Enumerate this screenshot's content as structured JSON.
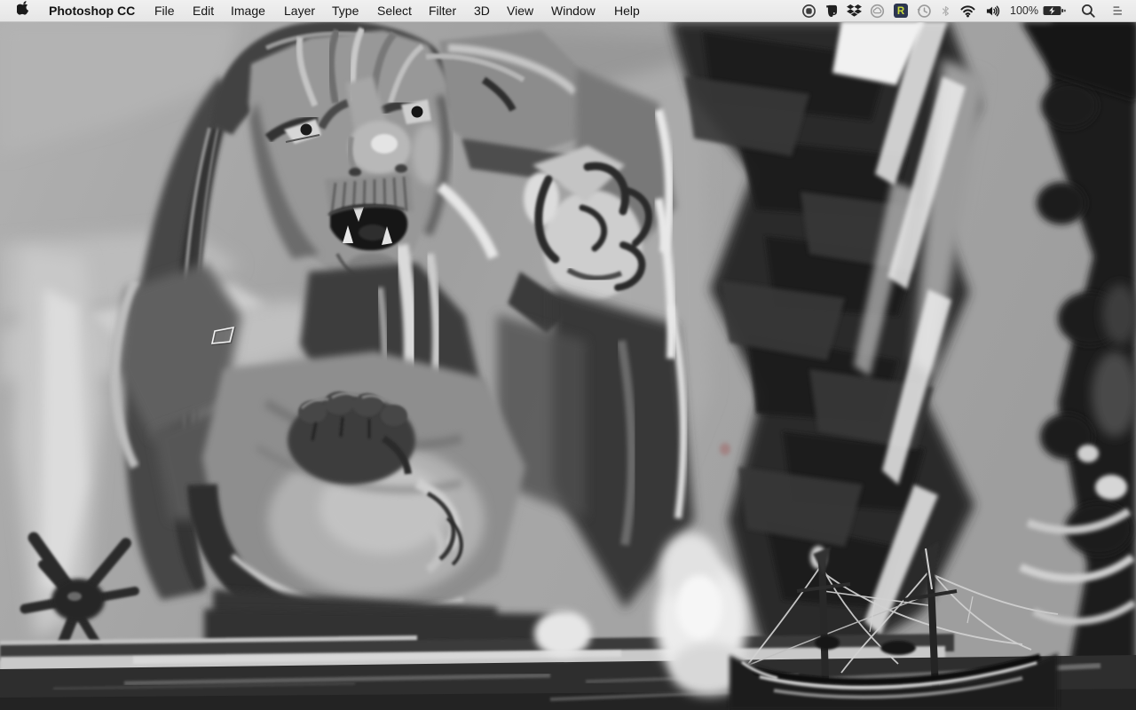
{
  "menu_bar": {
    "app_name": "Photoshop CC",
    "menus": [
      "File",
      "Edit",
      "Image",
      "Layer",
      "Type",
      "Select",
      "Filter",
      "3D",
      "View",
      "Window",
      "Help"
    ],
    "status": {
      "battery_percent": "100%",
      "rescuetime_letter": "R"
    }
  },
  "canvas": {
    "artwork_alt": "Grayscale digital painting: a giant angry troll leaning over a sea wall, a dark smoke column and a sailing ship at right"
  },
  "colors": {
    "menubar_bg": "#e9e9e9",
    "menubar_text": "#141414",
    "rescuetime_badge": "#2c3550",
    "rescuetime_text": "#c8da3a",
    "sky_gray": "#a3a3a3"
  }
}
